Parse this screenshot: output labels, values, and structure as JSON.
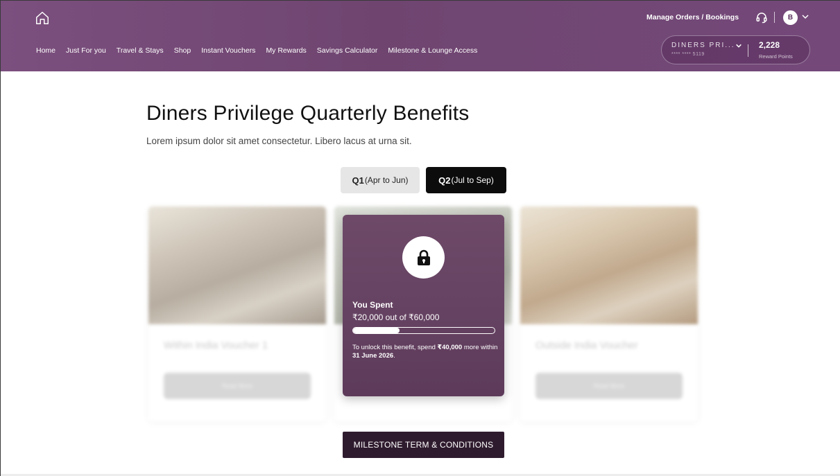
{
  "header": {
    "nav": [
      "Home",
      "Just For you",
      "Travel & Stays",
      "Shop",
      "Instant Vouchers",
      "My Rewards",
      "Savings Calculator",
      "Milestone & Lounge Access"
    ],
    "manage_label": "Manage Orders / Bookings",
    "avatar_letter": "B",
    "card": {
      "name": "DINERS PRI...",
      "number": "**** **** 5119",
      "points": "2,228",
      "points_label": "Reward Points"
    }
  },
  "main": {
    "title": "Diners Privilege Quarterly Benefits",
    "subtitle": "Lorem ipsum dolor sit amet consectetur. Libero lacus at urna sit.",
    "tabs": [
      {
        "code": "Q1",
        "range": "(Apr to Jun)",
        "selected": false
      },
      {
        "code": "Q2",
        "range": "(Jul to Sep)",
        "selected": true
      }
    ],
    "cards": [
      {
        "title": "Within India Voucher 1",
        "button": "Read More"
      },
      {
        "title": "",
        "button": ""
      },
      {
        "title": "Outside India Voucher",
        "button": "Read More"
      }
    ],
    "lock": {
      "spent_label": "You Spent",
      "spent_value": "₹20,000 out of ₹60,000",
      "progress": 0.33,
      "unlock_pre": "To unlock this benefit, spend ",
      "unlock_amount": "₹40,000",
      "unlock_mid": " more within ",
      "unlock_date": "31 June 2026",
      "unlock_end": "."
    },
    "tnc_label": "MILESTONE TERM & CONDITIONS"
  },
  "colors": {
    "header": "#74497a",
    "lock_card": "#654262",
    "tnc": "#2f1b2e"
  },
  "icons": [
    "home-icon",
    "headset-icon",
    "chevron-down-icon",
    "lock-icon"
  ]
}
